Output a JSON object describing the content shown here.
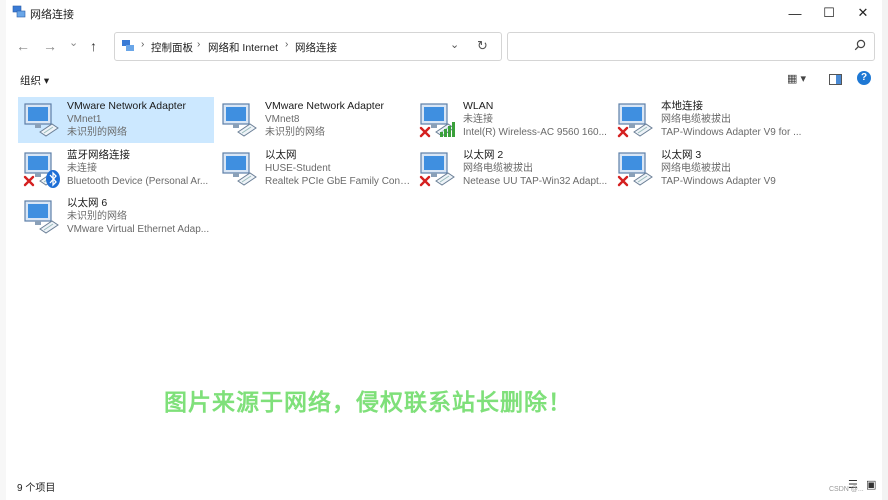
{
  "window": {
    "title": "网络连接"
  },
  "titlebar": {
    "min": "—",
    "max": "☐",
    "close": "✕"
  },
  "nav": {
    "back": "←",
    "forward": "→",
    "recent": "⌄",
    "up": "↑",
    "refresh": "↻",
    "dropdown": "⌄"
  },
  "address": {
    "sep": "›",
    "crumbs": [
      "控制面板",
      "网络和 Internet",
      "网络连接"
    ]
  },
  "search": {
    "placeholder": "",
    "icon": "search-icon"
  },
  "toolbar": {
    "organize": "组织 ▾",
    "view": "▦ ▾",
    "help": "?"
  },
  "items": [
    {
      "l1": "VMware Network Adapter",
      "l2": "VMnet1",
      "l3": "未识别的网络",
      "badge": "none"
    },
    {
      "l1": "VMware Network Adapter",
      "l2": "VMnet8",
      "l3": "未识别的网络",
      "badge": "none"
    },
    {
      "l1": "WLAN",
      "l2": "未连接",
      "l3": "Intel(R) Wireless-AC 9560 160...",
      "badge": "x-wifi"
    },
    {
      "l1": "本地连接",
      "l2": "网络电缆被拔出",
      "l3": "TAP-Windows Adapter V9 for ...",
      "badge": "x"
    },
    {
      "l1": "蓝牙网络连接",
      "l2": "未连接",
      "l3": "Bluetooth Device (Personal Ar...",
      "badge": "x-bt"
    },
    {
      "l1": "以太网",
      "l2": "HUSE-Student",
      "l3": "Realtek PCIe GbE Family Contr...",
      "badge": "none"
    },
    {
      "l1": "以太网 2",
      "l2": "网络电缆被拔出",
      "l3": "Netease UU TAP-Win32 Adapt...",
      "badge": "x"
    },
    {
      "l1": "以太网 3",
      "l2": "网络电缆被拔出",
      "l3": "TAP-Windows Adapter V9",
      "badge": "x"
    },
    {
      "l1": "以太网 6",
      "l2": "未识别的网络",
      "l3": "VMware Virtual Ethernet Adap...",
      "badge": "none"
    }
  ],
  "watermark": "图片来源于网络，侵权联系站长删除！",
  "status": {
    "count": "9 个项目"
  },
  "csdn": "CSDN @..."
}
